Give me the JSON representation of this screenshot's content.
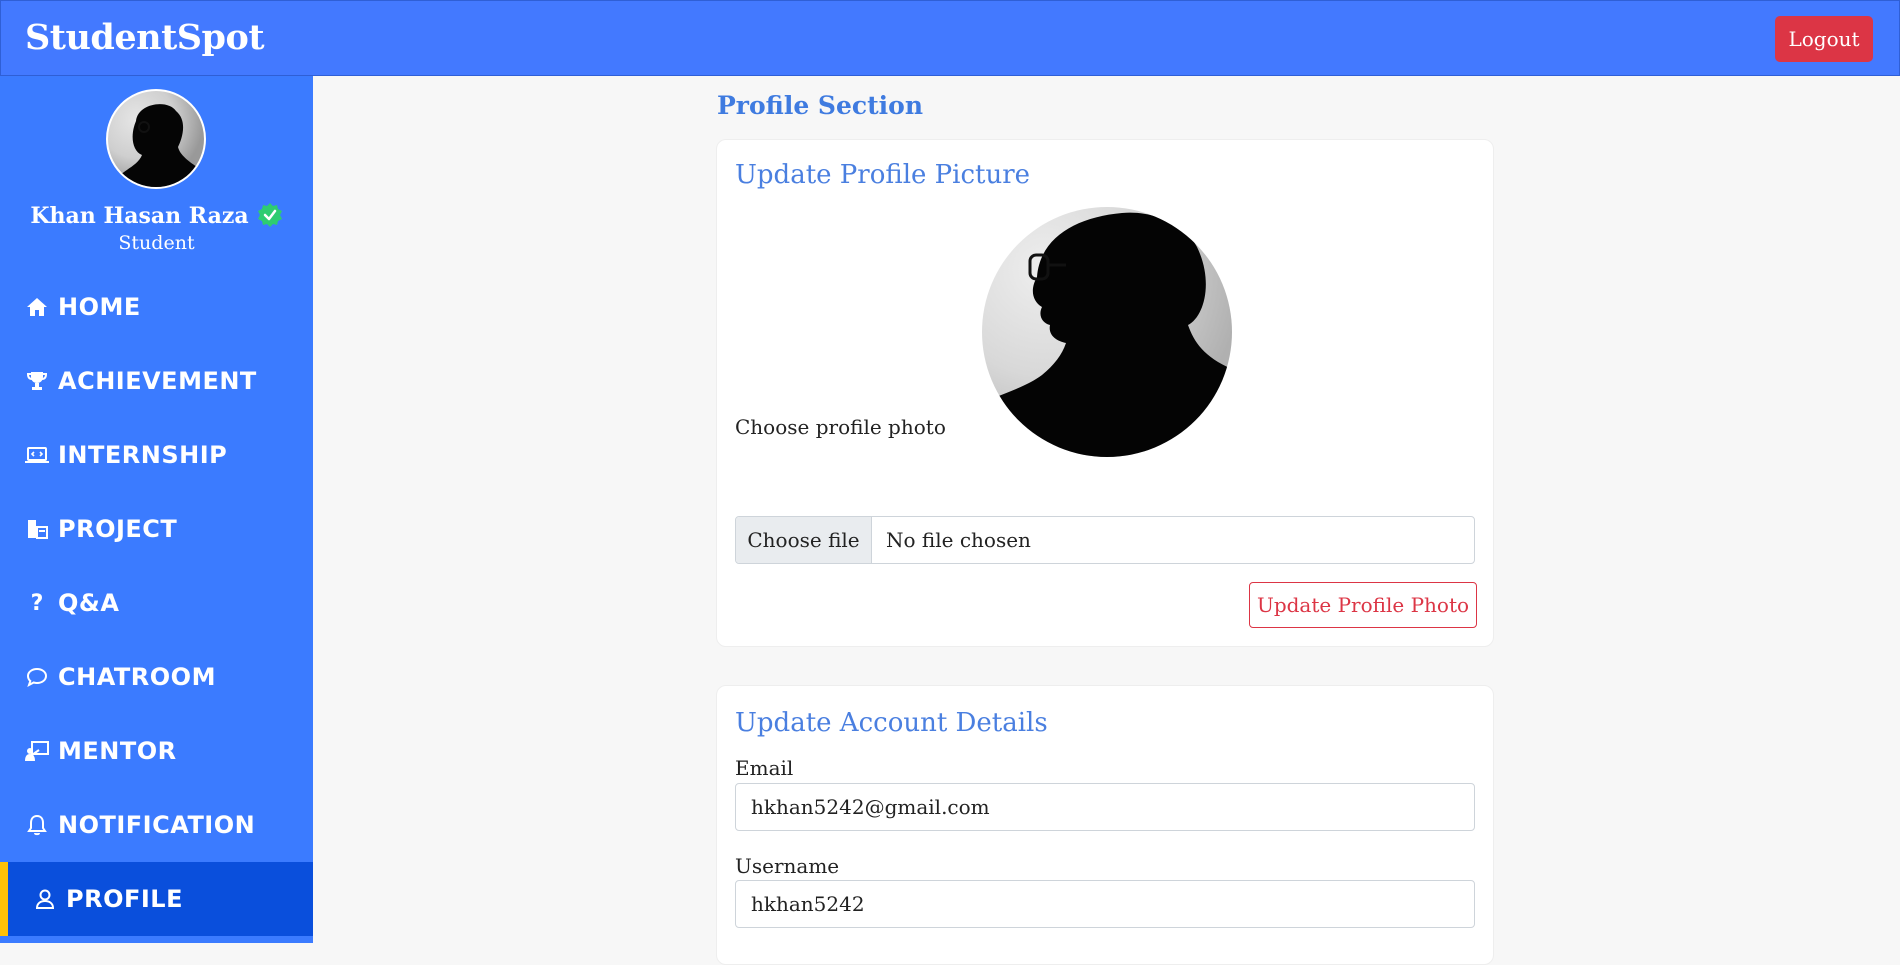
{
  "app": {
    "brand": "StudentSpot",
    "logout_label": "Logout"
  },
  "user": {
    "name": "Khan Hasan Raza",
    "role": "Student"
  },
  "nav": {
    "items": [
      {
        "label": "HOME",
        "icon": "home-icon"
      },
      {
        "label": "ACHIEVEMENT",
        "icon": "trophy-icon"
      },
      {
        "label": "INTERNSHIP",
        "icon": "laptop-code-icon"
      },
      {
        "label": "PROJECT",
        "icon": "project-icon"
      },
      {
        "label": "Q&A",
        "icon": "question-icon"
      },
      {
        "label": "CHATROOM",
        "icon": "chat-icon"
      },
      {
        "label": "MENTOR",
        "icon": "mentor-icon"
      },
      {
        "label": "NOTIFICATION",
        "icon": "bell-icon"
      },
      {
        "label": "PROFILE",
        "icon": "user-icon",
        "active": true
      }
    ]
  },
  "main": {
    "section_title": "Profile Section",
    "photo_card": {
      "title": "Update Profile Picture",
      "choose_label": "Choose profile photo",
      "file_button": "Choose file",
      "file_status": "No file chosen",
      "submit_label": "Update Profile Photo"
    },
    "account_card": {
      "title": "Update Account Details",
      "email_label": "Email",
      "email_value": "hkhan5242@gmail.com",
      "username_label": "Username",
      "username_value": "hkhan5242"
    }
  },
  "colors": {
    "header": "#4379ff",
    "sidebar": "#3b7bff",
    "sidebar_active": "#0a4fdc",
    "active_marker": "#ffc107",
    "danger": "#dc3545",
    "accent_title": "#3f7be0",
    "verified": "#2ecc71"
  }
}
